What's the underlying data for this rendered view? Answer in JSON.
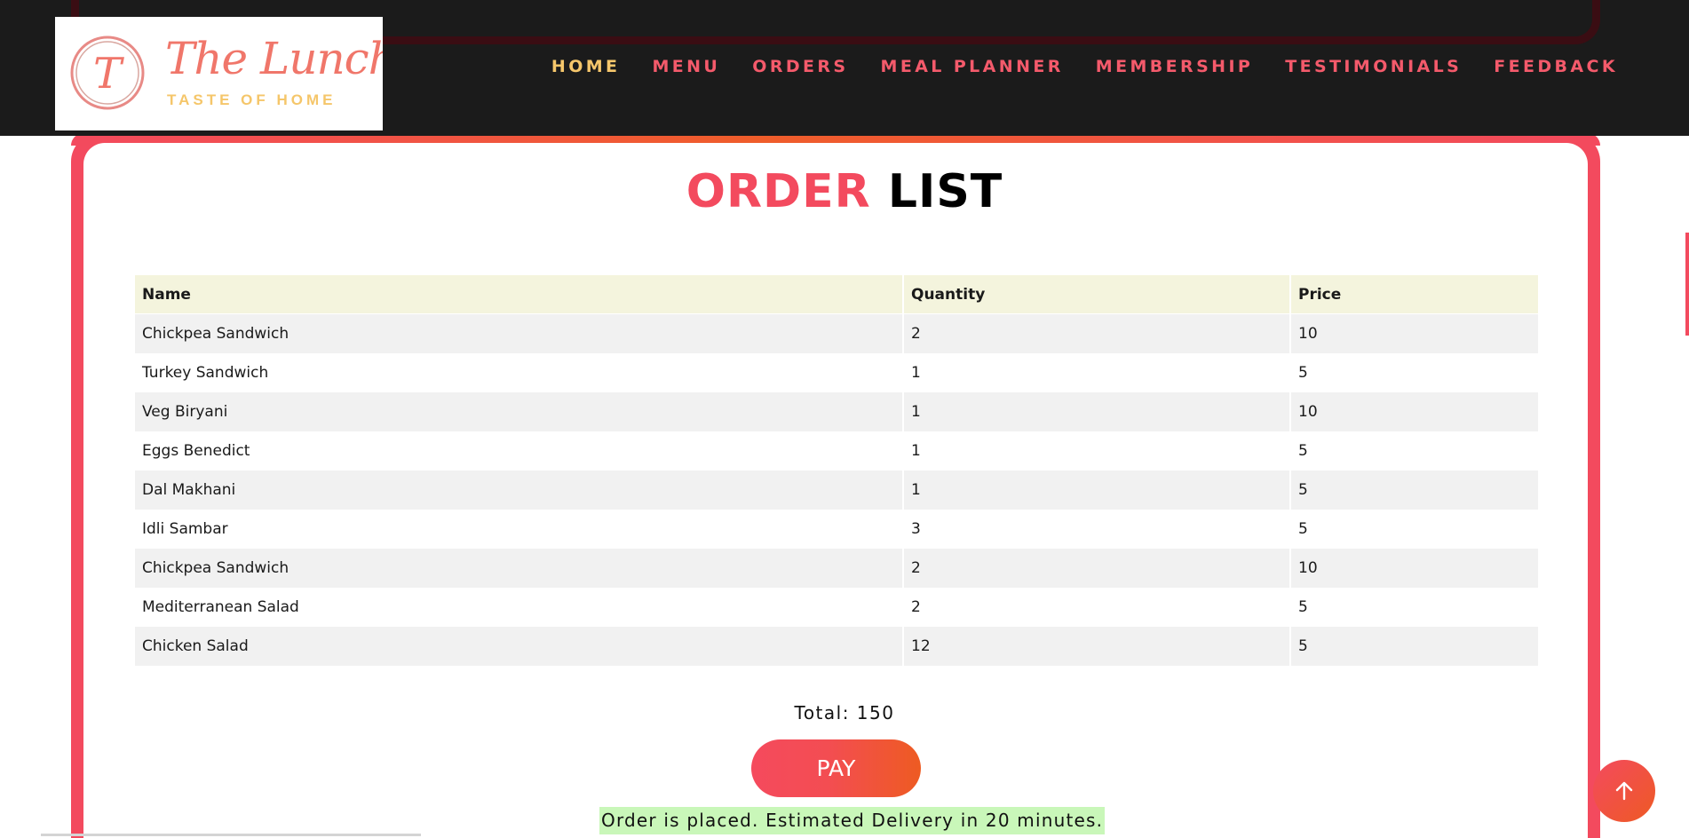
{
  "brand": {
    "logo_letter": "T",
    "name": "The Lunchbox",
    "tagline": "TASTE OF HOME"
  },
  "nav": {
    "items": [
      {
        "label": "HOME",
        "active": true
      },
      {
        "label": "MENU"
      },
      {
        "label": "ORDERS"
      },
      {
        "label": "MEAL PLANNER"
      },
      {
        "label": "MEMBERSHIP"
      },
      {
        "label": "TESTIMONIALS"
      },
      {
        "label": "FEEDBACK"
      }
    ]
  },
  "page": {
    "title_accent": "ORDER",
    "title_rest": "LIST"
  },
  "table": {
    "headers": [
      "Name",
      "Quantity",
      "Price"
    ],
    "rows": [
      [
        "Chickpea Sandwich",
        "2",
        "10"
      ],
      [
        "Turkey Sandwich",
        "1",
        "5"
      ],
      [
        "Veg Biryani",
        "1",
        "10"
      ],
      [
        "Eggs Benedict",
        "1",
        "5"
      ],
      [
        "Dal Makhani",
        "1",
        "5"
      ],
      [
        "Idli Sambar",
        "3",
        "5"
      ],
      [
        "Chickpea Sandwich",
        "2",
        "10"
      ],
      [
        "Mediterranean Salad",
        "2",
        "5"
      ],
      [
        "Chicken Salad",
        "12",
        "5"
      ]
    ]
  },
  "summary": {
    "total_text": "Total: 150",
    "pay_label": "PAY",
    "status_message": "Order is placed. Estimated Delivery in 20 minutes."
  },
  "icons": {
    "scroll_top": "arrow-up-icon"
  },
  "colors": {
    "accent": "#f34a5e",
    "accent_orange": "#ee5a24",
    "nav_active": "#f6c76b",
    "navbar_bg": "#1b1b1b",
    "header_row_bg": "#f4f4dd",
    "status_bg": "#c9f7b9"
  }
}
